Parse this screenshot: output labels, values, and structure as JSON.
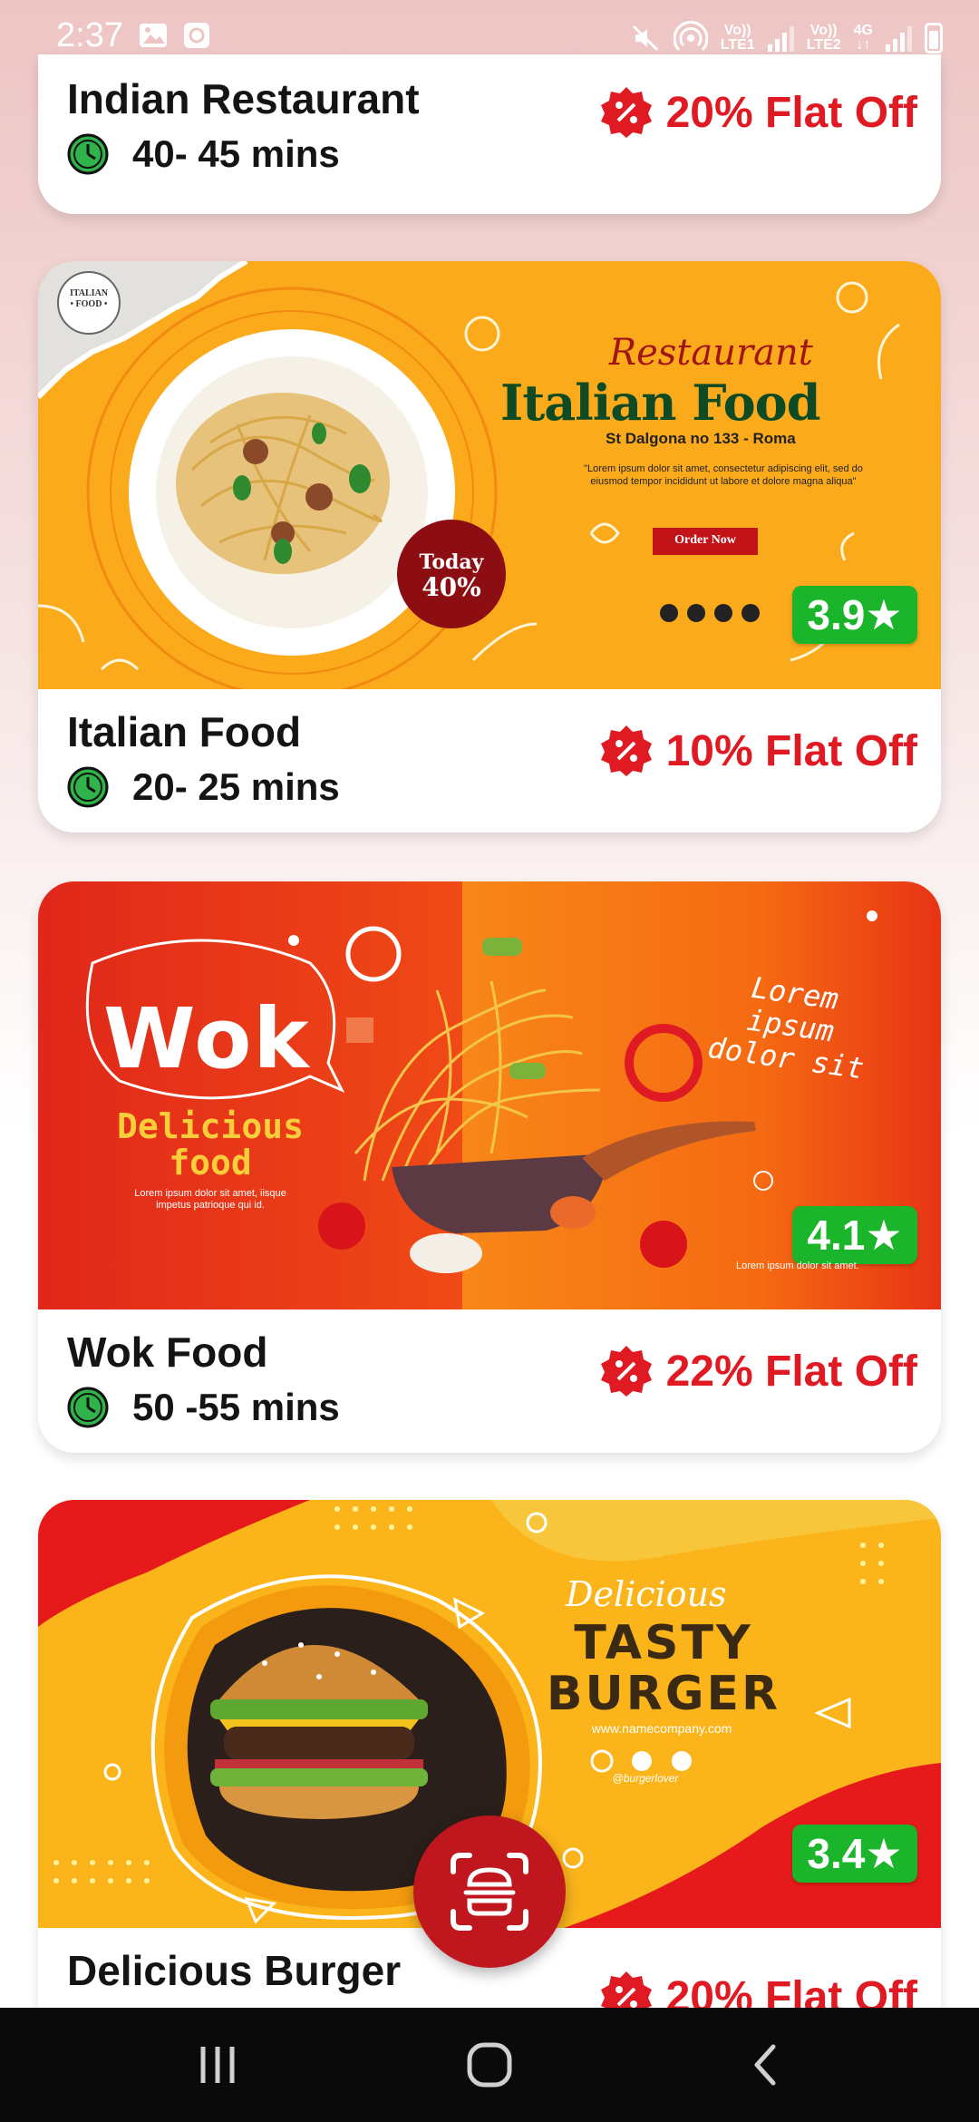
{
  "status_bar": {
    "time": "2:37",
    "sim1_top": "Vo))",
    "sim1_bottom": "LTE1",
    "sim2_top": "Vo))",
    "sim2_bottom": "LTE2",
    "net_top": "4G",
    "net_bottom": "↓↑",
    "icons": [
      "gallery-icon",
      "app-notification-icon",
      "mute-icon",
      "hotspot-icon",
      "signal-icon",
      "battery-icon"
    ]
  },
  "restaurants": [
    {
      "name": "Indian Restaurant",
      "time": "40- 45 mins",
      "offer": "20% Flat Off"
    },
    {
      "name": "Italian Food",
      "time": "20- 25 mins",
      "offer": "10% Flat Off",
      "rating": "3.9★",
      "banner": {
        "logo_line1": "ITALIAN",
        "logo_line2": "• FOOD •",
        "script_title": "Restaurant",
        "title": "Italian Food",
        "address": "St Dalgona no 133 - Roma",
        "lorem_line1": "\"Lorem ipsum dolor sit amet, consectetur adipiscing elit, sed do",
        "lorem_line2": "eiusmod tempor incididunt ut labore et dolore magna aliqua\"",
        "button": "Order Now",
        "promo_line1": "Today",
        "promo_line2": "40%"
      }
    },
    {
      "name": "Wok Food",
      "time": "50 -55 mins",
      "offer": "22% Flat Off",
      "rating": "4.1★",
      "banner": {
        "title": "Wok",
        "sub1": "Delicious",
        "sub2": "food",
        "small1": "Lorem ipsum dolor sit amet, iisque",
        "small2": "impetus patrioque qui id.",
        "right1": "Lorem",
        "right2": "ipsum",
        "right3": "dolor sit",
        "bottom": "Lorem ipsum dolor sit amet."
      }
    },
    {
      "name": "Delicious Burger",
      "offer": "20% Flat Off",
      "rating": "3.4★",
      "banner": {
        "script": "Delicious",
        "title1": "TASTY",
        "title2": "BURGER",
        "site": "www.namecompany.com",
        "handle": "@burgerlover"
      }
    }
  ],
  "colors": {
    "offer_red": "#e01a22",
    "rating_green": "#1ab52a",
    "fab_red": "#c0161d"
  }
}
